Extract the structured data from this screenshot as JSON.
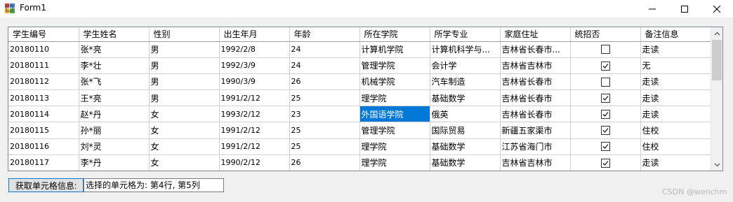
{
  "window": {
    "title": "Form1",
    "controls": [
      "minimize-icon",
      "maximize-icon",
      "close-icon"
    ]
  },
  "grid": {
    "columns": [
      "学生编号",
      "学生姓名",
      "性别",
      "出生年月",
      "年龄",
      "所在学院",
      "所学专业",
      "家庭住址",
      "统招否",
      "备注信息"
    ],
    "rows": [
      [
        "20180110",
        "张*亮",
        "男",
        "1992/2/8",
        "24",
        "计算机学院",
        "计算机科学与...",
        "吉林省长春市...",
        false,
        "走读"
      ],
      [
        "20180111",
        "李*壮",
        "男",
        "1992/3/9",
        "24",
        "管理学院",
        "会计学",
        "吉林省吉林市",
        true,
        "无"
      ],
      [
        "20180112",
        "张*飞",
        "男",
        "1990/3/9",
        "26",
        "机械学院",
        "汽车制造",
        "吉林省长春市",
        false,
        "走读"
      ],
      [
        "20180113",
        "王*亮",
        "男",
        "1991/2/12",
        "25",
        "理学院",
        "基础数学",
        "吉林省长春市",
        true,
        "走读"
      ],
      [
        "20180114",
        "赵*丹",
        "女",
        "1993/2/12",
        "23",
        "外国语学院",
        "俄英",
        "吉林省长春市",
        true,
        "走读"
      ],
      [
        "20180115",
        "孙*丽",
        "女",
        "1991/2/12",
        "25",
        "管理学院",
        "国际贸易",
        "新疆五家渠市",
        true,
        "住校"
      ],
      [
        "20180116",
        "刘*灵",
        "女",
        "1991/2/12",
        "25",
        "理学院",
        "基础数学",
        "江苏省海门市",
        true,
        "住校"
      ],
      [
        "20180117",
        "李*丹",
        "女",
        "1990/2/12",
        "26",
        "理学院",
        "基础数学",
        "吉林省吉林市",
        true,
        "走读"
      ]
    ],
    "selected_cell": {
      "row": 4,
      "col": 5
    }
  },
  "footer": {
    "button_label": "获取单元格信息:",
    "result_text": "选择的单元格为: 第4行, 第5列"
  },
  "watermark": "CSDN @wenchm",
  "colors": {
    "selection": "#0078d7",
    "titlebar": "#ffffff",
    "window_bg": "#f0f0f0"
  }
}
